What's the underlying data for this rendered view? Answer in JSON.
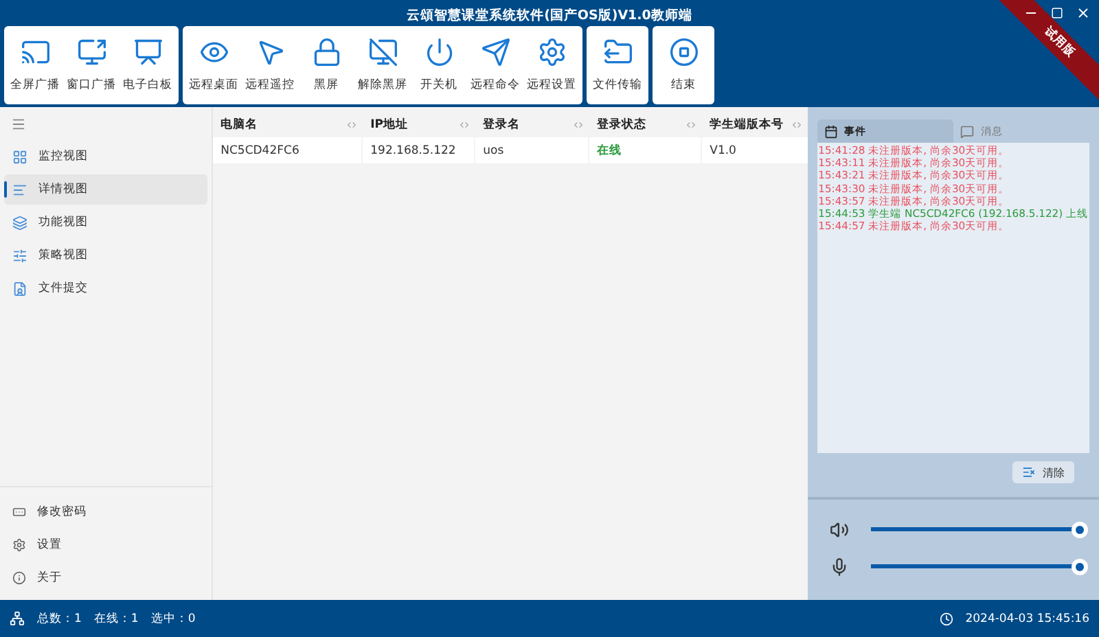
{
  "window": {
    "title": "云頌智慧课堂系统软件(国产OS版)V1.0教师端",
    "badge": "试用版"
  },
  "toolbar": [
    {
      "buttons": [
        {
          "label": "全屏广播"
        },
        {
          "label": "窗口广播"
        },
        {
          "label": "电子白板"
        }
      ]
    },
    {
      "buttons": [
        {
          "label": "远程桌面"
        },
        {
          "label": "远程遥控"
        },
        {
          "label": "黑屏"
        },
        {
          "label": "解除黑屏"
        },
        {
          "label": "开关机"
        },
        {
          "label": "远程命令"
        },
        {
          "label": "远程设置"
        }
      ]
    },
    {
      "buttons": [
        {
          "label": "文件传输"
        }
      ]
    },
    {
      "buttons": [
        {
          "label": "结束"
        }
      ]
    }
  ],
  "sidebar": {
    "items": [
      {
        "label": "监控视图",
        "selected": false
      },
      {
        "label": "详情视图",
        "selected": true
      },
      {
        "label": "功能视图",
        "selected": false
      },
      {
        "label": "策略视图",
        "selected": false
      },
      {
        "label": "文件提交",
        "selected": false
      }
    ],
    "bottom_items": [
      {
        "label": "修改密码"
      },
      {
        "label": "设置"
      },
      {
        "label": "关于"
      }
    ]
  },
  "table": {
    "columns": [
      "电脑名",
      "IP地址",
      "登录名",
      "登录状态",
      "学生端版本号"
    ],
    "rows": [
      {
        "name": "NC5CD42FC6",
        "ip": "192.168.5.122",
        "login": "uos",
        "status": "在线",
        "online": true,
        "version": "V1.0"
      }
    ]
  },
  "log_panel": {
    "tabs": [
      {
        "label": "事件",
        "selected": true
      },
      {
        "label": "消息",
        "selected": false
      }
    ],
    "entries": [
      {
        "text": "15:41:28 未注册版本, 尚余30天可用。",
        "color": "#e8505f"
      },
      {
        "text": "15:43:11 未注册版本, 尚余30天可用。",
        "color": "#e8505f"
      },
      {
        "text": "15:43:21 未注册版本, 尚余30天可用。",
        "color": "#e8505f"
      },
      {
        "text": "15:43:30 未注册版本, 尚余30天可用。",
        "color": "#e8505f"
      },
      {
        "text": "15:43:57 未注册版本, 尚余30天可用。",
        "color": "#e8505f"
      },
      {
        "text": "15:44:53 学生端 NC5CD42FC6 (192.168.5.122) 上线",
        "color": "#2c9a3c"
      },
      {
        "text": "15:44:57 未注册版本, 尚余30天可用。",
        "color": "#e8505f"
      }
    ],
    "clear_button": "清除"
  },
  "audio": {
    "speaker": {
      "level": 1
    },
    "microphone": {
      "level": 1
    }
  },
  "status_bar": {
    "total": "总数：1",
    "online": "在线：1",
    "selected": "选中：0",
    "datetime": "2024-04-03 15:45:16"
  }
}
